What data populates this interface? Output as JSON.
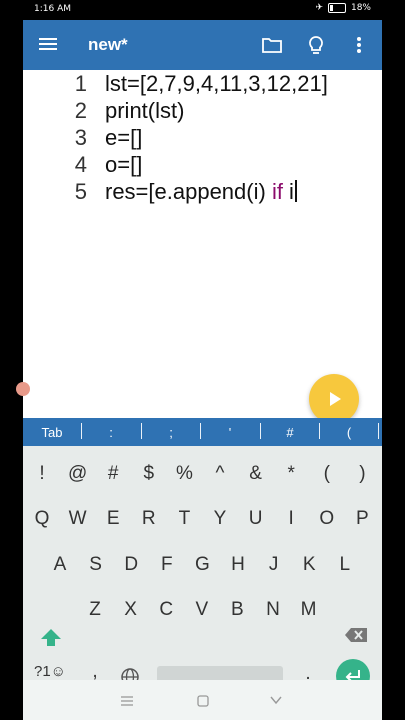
{
  "status": {
    "time": "1:16 AM",
    "battery": "18%"
  },
  "appbar": {
    "title": "new*",
    "icons": [
      "menu-icon",
      "folder-icon",
      "lightbulb-icon",
      "more-vert-icon"
    ]
  },
  "editor": {
    "lines": [
      {
        "num": "1",
        "code": "lst=[2,7,9,4,11,3,12,21]"
      },
      {
        "num": "2",
        "code": "print(lst)"
      },
      {
        "num": "3",
        "code": "e=[]"
      },
      {
        "num": "4",
        "code": "o=[]"
      },
      {
        "num": "5",
        "code_pre": "res=[e.append(i) ",
        "code_kw": "if",
        "code_post": " i"
      }
    ],
    "keyword_color": "#8b0b6b"
  },
  "symbols": [
    "Tab",
    ":",
    ";",
    "'",
    "#",
    "("
  ],
  "keyboard": {
    "row0": [
      "!",
      "@",
      "#",
      "$",
      "%",
      "^",
      "&",
      "*",
      "(",
      ")"
    ],
    "row1": [
      "Q",
      "W",
      "E",
      "R",
      "T",
      "Y",
      "U",
      "I",
      "O",
      "P"
    ],
    "row2": [
      "A",
      "S",
      "D",
      "F",
      "G",
      "H",
      "J",
      "K",
      "L"
    ],
    "row3": [
      "Z",
      "X",
      "C",
      "V",
      "B",
      "N",
      "M"
    ],
    "row4": {
      "sym": "?1☺",
      "comma": ",",
      "period": "."
    }
  },
  "colors": {
    "appbar": "#2f72b3",
    "fab": "#f7c83d",
    "enter": "#35b38a",
    "shift": "#35b38a"
  }
}
